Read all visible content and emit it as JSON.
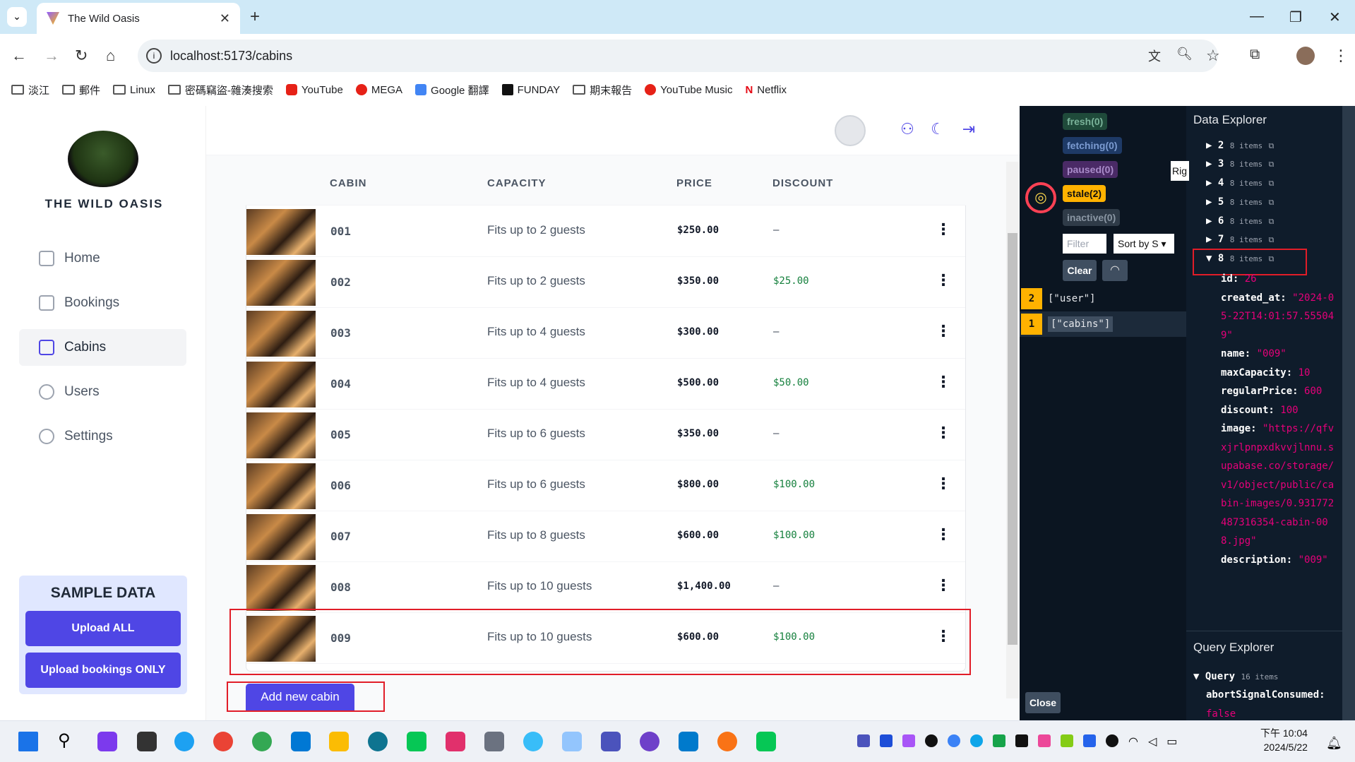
{
  "browser": {
    "tab_title": "The Wild Oasis",
    "url": "localhost:5173/cabins",
    "bookmarks": [
      "淡江",
      "郵件",
      "Linux",
      "密碼竊盜-雜湊搜索",
      "YouTube",
      "MEGA",
      "Google 翻譯",
      "FUNDAY",
      "期末報告",
      "YouTube Music",
      "Netflix"
    ]
  },
  "app": {
    "brand": "THE WILD OASIS",
    "nav": [
      {
        "label": "Home",
        "icon": "home-icon"
      },
      {
        "label": "Bookings",
        "icon": "calendar-icon"
      },
      {
        "label": "Cabins",
        "icon": "buildings-icon",
        "active": true
      },
      {
        "label": "Users",
        "icon": "users-icon"
      },
      {
        "label": "Settings",
        "icon": "gear-icon"
      }
    ],
    "sample": {
      "title": "SAMPLE DATA",
      "upload_all": "Upload ALL",
      "upload_bookings": "Upload bookings ONLY"
    },
    "table": {
      "headers": [
        "CABIN",
        "CAPACITY",
        "PRICE",
        "DISCOUNT"
      ],
      "rows": [
        {
          "name": "001",
          "capacity": "Fits up to 2 guests",
          "price": "$250.00",
          "discount": "—"
        },
        {
          "name": "002",
          "capacity": "Fits up to 2 guests",
          "price": "$350.00",
          "discount": "$25.00"
        },
        {
          "name": "003",
          "capacity": "Fits up to 4 guests",
          "price": "$300.00",
          "discount": "—"
        },
        {
          "name": "004",
          "capacity": "Fits up to 4 guests",
          "price": "$500.00",
          "discount": "$50.00"
        },
        {
          "name": "005",
          "capacity": "Fits up to 6 guests",
          "price": "$350.00",
          "discount": "—"
        },
        {
          "name": "006",
          "capacity": "Fits up to 6 guests",
          "price": "$800.00",
          "discount": "$100.00"
        },
        {
          "name": "007",
          "capacity": "Fits up to 8 guests",
          "price": "$600.00",
          "discount": "$100.00"
        },
        {
          "name": "008",
          "capacity": "Fits up to 10 guests",
          "price": "$1,400.00",
          "discount": "—"
        },
        {
          "name": "009",
          "capacity": "Fits up to 10 guests",
          "price": "$600.00",
          "discount": "$100.00"
        }
      ],
      "kebab": "⋮"
    },
    "add_button": "Add new cabin"
  },
  "devtools": {
    "status": {
      "fresh": "fresh(0)",
      "fetching": "fetching(0)",
      "paused": "paused(0)",
      "stale": "stale(2)",
      "inactive": "inactive(0)"
    },
    "filter_placeholder": "Filter",
    "sort_label": "Sort by S",
    "clear": "Clear",
    "right_label": "Rig",
    "queries": [
      {
        "count": "2",
        "key": "[\"user\"]"
      },
      {
        "count": "1",
        "key": "[\"cabins\"]"
      }
    ],
    "data_explorer": "Data Explorer",
    "tree": [
      {
        "index": "2",
        "items": "8 items"
      },
      {
        "index": "3",
        "items": "8 items"
      },
      {
        "index": "4",
        "items": "8 items"
      },
      {
        "index": "5",
        "items": "8 items"
      },
      {
        "index": "6",
        "items": "8 items"
      },
      {
        "index": "7",
        "items": "8 items"
      },
      {
        "index": "8",
        "items": "8 items"
      }
    ],
    "fields": {
      "id_key": "id:",
      "id_val": "26",
      "created_key": "created_at:",
      "created_val": "\"2024-05-22T14:01:57.555049\"",
      "name_key": "name:",
      "name_val": "\"009\"",
      "max_key": "maxCapacity:",
      "max_val": "10",
      "price_key": "regularPrice:",
      "price_val": "600",
      "disc_key": "discount:",
      "disc_val": "100",
      "image_key": "image:",
      "image_val": "\"https://qfvxjrlpnpxdkvvjlnnu.supabase.co/storage/v1/object/public/cabin-images/0.931772487316354-cabin-008.jpg\"",
      "desc_key": "description:",
      "desc_val": "\"009\""
    },
    "query_explorer": "Query Explorer",
    "query_label": "Query",
    "query_items": "16 items",
    "abort_key": "abortSignalConsumed:",
    "abort_val": "false",
    "close": "Close"
  },
  "taskbar": {
    "time": "下午 10:04",
    "date": "2024/5/22"
  }
}
